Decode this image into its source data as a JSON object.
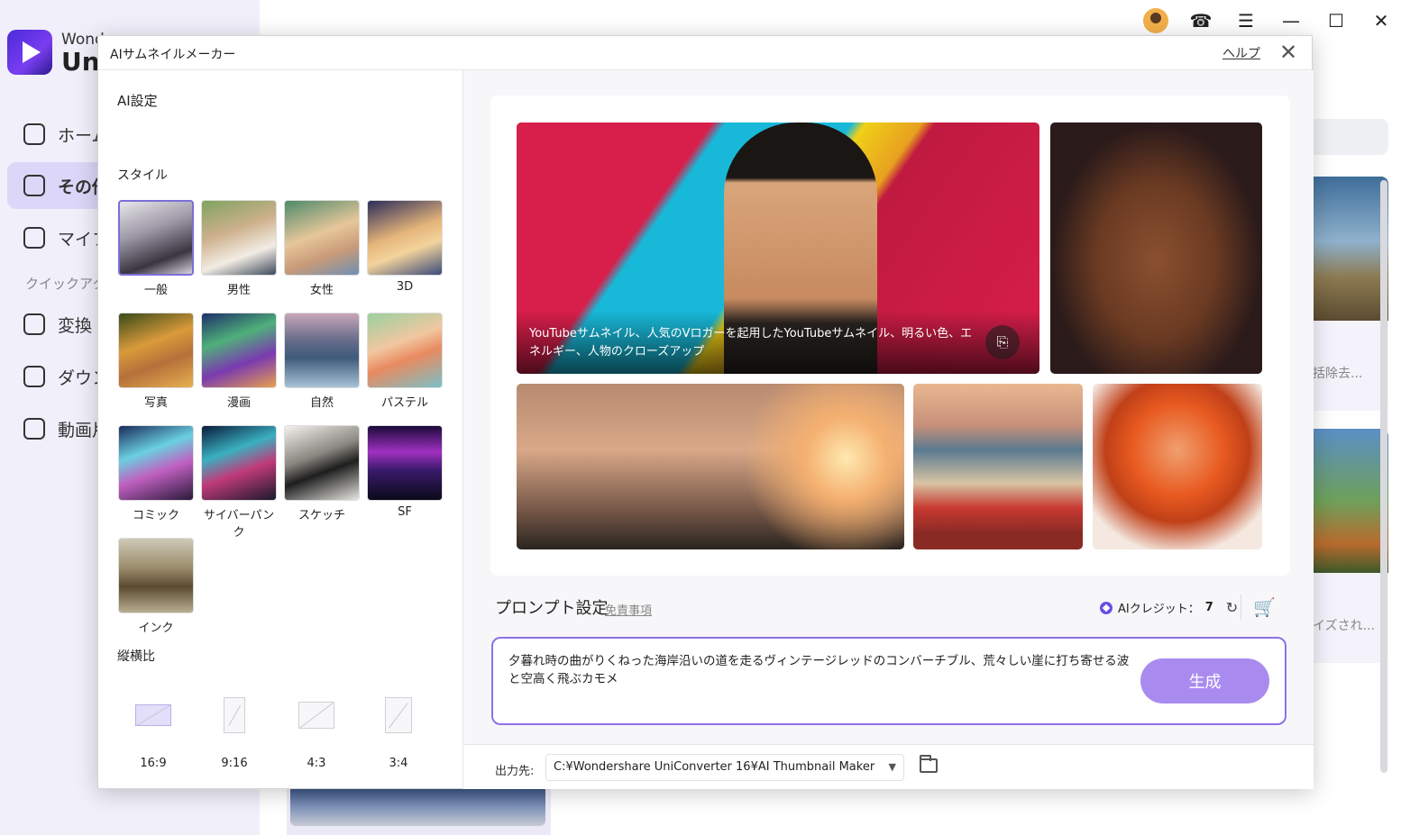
{
  "app": {
    "brand_line1": "Wonders",
    "brand_line2": "Un",
    "nav": [
      {
        "label": "ホーム"
      },
      {
        "label": "その他"
      },
      {
        "label": "マイフ"
      },
      {
        "label": "変換"
      },
      {
        "label": "ダウン"
      },
      {
        "label": "動画片"
      }
    ],
    "quick_section": "クイックアク",
    "card1_text": "括除去...",
    "card2_text": "イズされ..."
  },
  "dialog": {
    "title": "AIサムネイルメーカー",
    "help": "ヘルプ",
    "ai_settings": "AI設定",
    "style_label": "スタイル",
    "styles": [
      {
        "label": "一般",
        "icon": "style-general-thumb"
      },
      {
        "label": "男性",
        "icon": "style-male-thumb"
      },
      {
        "label": "女性",
        "icon": "style-female-thumb"
      },
      {
        "label": "3D",
        "icon": "style-3d-thumb"
      },
      {
        "label": "写真",
        "icon": "style-photo-thumb"
      },
      {
        "label": "漫画",
        "icon": "style-manga-thumb"
      },
      {
        "label": "自然",
        "icon": "style-nature-thumb"
      },
      {
        "label": "パステル",
        "icon": "style-pastel-thumb"
      },
      {
        "label": "コミック",
        "icon": "style-comic-thumb"
      },
      {
        "label": "サイバーパンク",
        "icon": "style-cyberpunk-thumb"
      },
      {
        "label": "スケッチ",
        "icon": "style-sketch-thumb"
      },
      {
        "label": "SF",
        "icon": "style-sf-thumb"
      },
      {
        "label": "インク",
        "icon": "style-ink-thumb"
      }
    ],
    "selected_style": "一般",
    "ratio_label": "縦横比",
    "ratios": [
      {
        "label": "16:9"
      },
      {
        "label": "9:16"
      },
      {
        "label": "4:3"
      },
      {
        "label": "3:4"
      }
    ],
    "selected_ratio": "16:9",
    "gallery_caption": "YouTubeサムネイル、人気のVロガーを起用したYouTubeサムネイル、明るい色、エネルギー、人物のクローズアップ",
    "prompt_title": "プロンプト設定",
    "disclaimer": "免責事項",
    "credits_label": "AIクレジット：",
    "credits_value": "7",
    "prompt_text": "夕暮れ時の曲がりくねった海岸沿いの道を走るヴィンテージレッドのコンバーチブル、荒々しい崖に打ち寄せる波と空高く飛ぶカモメ",
    "generate": "生成",
    "output_label": "出力先:",
    "output_path": "C:¥Wondershare UniConverter 16¥AI Thumbnail Maker"
  },
  "colors": {
    "accent": "#8c72e6",
    "button": "#a98bf0",
    "sidebar_active": "#dcd7f8"
  }
}
